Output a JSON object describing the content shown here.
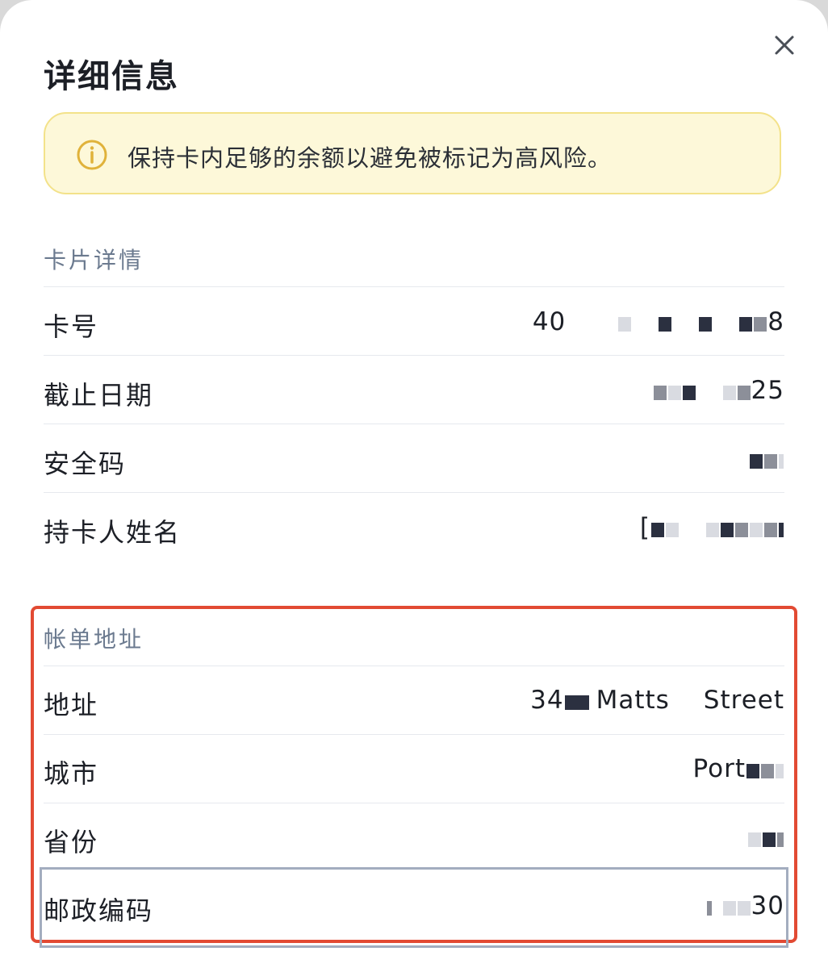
{
  "dialog": {
    "title": "详细信息",
    "close_icon": "close-icon"
  },
  "notice": {
    "icon": "info-circle-icon",
    "text": "保持卡内足够的余额以避免被标记为高风险。",
    "accent": "#e0b23a"
  },
  "card_details": {
    "section_title": "卡片详情",
    "rows": [
      {
        "label": "卡号",
        "value_prefix": "40",
        "value_suffix": "8"
      },
      {
        "label": "截止日期",
        "value_prefix": "",
        "value_suffix": "25"
      },
      {
        "label": "安全码",
        "value_prefix": "",
        "value_suffix": ""
      },
      {
        "label": "持卡人姓名",
        "value_prefix": "[",
        "value_suffix": ""
      }
    ]
  },
  "billing_address": {
    "section_title": "帐单地址",
    "rows": [
      {
        "label": "地址",
        "value_prefix": "34",
        "value_middle": "Matts",
        "value_suffix": "Street"
      },
      {
        "label": "城市",
        "value_prefix": "Port",
        "value_suffix": ""
      },
      {
        "label": "省份",
        "value_prefix": "",
        "value_suffix": ""
      },
      {
        "label": "邮政编码",
        "value_prefix": "",
        "value_suffix": "30"
      }
    ]
  },
  "colors": {
    "highlight_red": "#e24a33",
    "highlight_blue": "#a3adbf",
    "section_title": "#6b7a8f"
  }
}
